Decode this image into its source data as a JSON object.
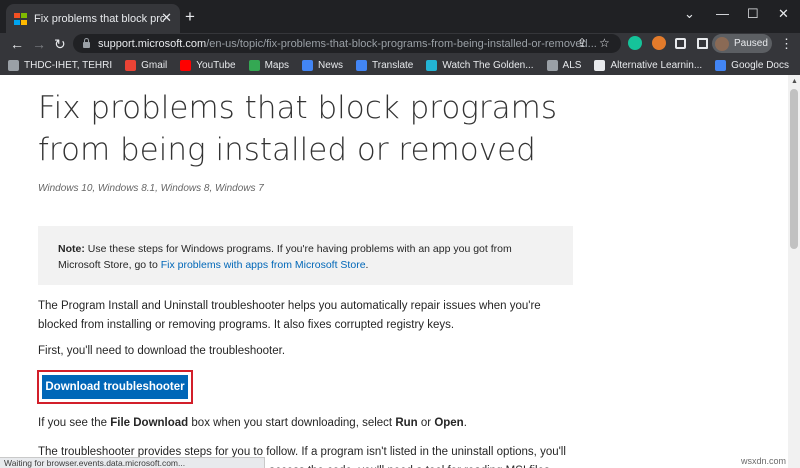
{
  "tab": {
    "title": "Fix problems that block programs",
    "close_glyph": "✕",
    "new_tab_glyph": "+"
  },
  "window_controls": {
    "minimize": "—",
    "maximize": "☐",
    "close": "✕",
    "chevron": "⌄"
  },
  "toolbar": {
    "back": "←",
    "forward": "→",
    "reload": "↻",
    "url_domain": "support.microsoft.com",
    "url_path": "/en-us/topic/fix-problems-that-block-programs-from-being-installed-or-removed...",
    "share": "⇪",
    "star": "☆",
    "profile_status": "Paused",
    "menu": "⋮"
  },
  "bookmarks": [
    {
      "label": "THDC-IHET, TEHRI",
      "color": "#9aa0a6"
    },
    {
      "label": "Gmail",
      "color": "#ea4335"
    },
    {
      "label": "YouTube",
      "color": "#ff0000"
    },
    {
      "label": "Maps",
      "color": "#34a853"
    },
    {
      "label": "News",
      "color": "#4285f4"
    },
    {
      "label": "Translate",
      "color": "#4285f4"
    },
    {
      "label": "Watch The Golden...",
      "color": "#23b4d4"
    },
    {
      "label": "ALS",
      "color": "#9aa0a6"
    },
    {
      "label": "Alternative Learnin...",
      "color": "#e8eaed"
    },
    {
      "label": "Google Docs",
      "color": "#4285f4"
    }
  ],
  "page": {
    "title": "Fix problems that block programs from being installed or removed",
    "applies_to": "Windows 10, Windows 8.1, Windows 8, Windows 7",
    "note_label": "Note:",
    "note_text": " Use these steps for Windows programs. If you're having problems with an app you got from Microsoft Store, go to ",
    "note_link": "Fix problems with apps from Microsoft Store",
    "note_end": ".",
    "intro": "The Program Install and Uninstall troubleshooter helps you automatically repair issues when you're blocked from installing or removing programs. It also fixes corrupted registry keys.",
    "first_step": "First, you'll need to download the troubleshooter.",
    "download_button": "Download troubleshooter",
    "file_download_pre": "If you see the ",
    "file_download_bold": "File Download",
    "file_download_mid": " box when you start downloading, select ",
    "run_bold": "Run",
    "or_text": " or ",
    "open_bold": "Open",
    "period": ".",
    "steps_text": "The troubleshooter provides steps for you to follow. If a program isn't listed in the uninstall options, you'll be asked for that program's product code. To access the code, you'll need a tool for reading MSI files"
  },
  "status_bar": "Waiting for browser.events.data.microsoft.com...",
  "watermark": "wsxdn.com",
  "colors": {
    "accent": "#0067b8",
    "highlight_border": "#d21f2a"
  }
}
